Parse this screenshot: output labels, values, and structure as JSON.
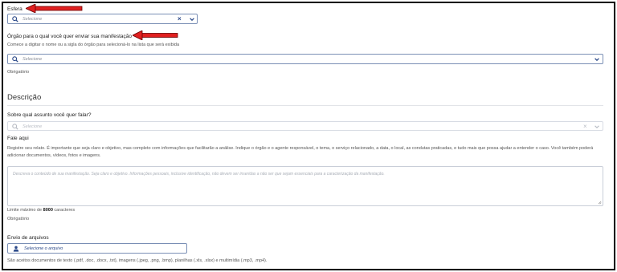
{
  "esfera": {
    "label": "Esfera",
    "placeholder": "Selecione"
  },
  "orgao": {
    "label": "Órgão para o qual você quer enviar sua manifestação",
    "help": "Comece a digitar o nome ou a sigla do órgão para selecioná-lo na lista que será exibida",
    "placeholder": "Selecione",
    "required": "Obrigatório"
  },
  "descricao": {
    "title": "Descrição",
    "assunto_label": "Sobre qual assunto você quer falar?",
    "assunto_placeholder": "Selecione",
    "fale_label": "Fale aqui",
    "instructions": "Registre seu relato. É importante que seja claro e objetivo, mas completo com informações que facilitarão a análise. Indique o órgão e o agente responsável, o tema, o serviço relacionado, a data, o local, as condutas praticadas, e tudo mais que possa ajudar a entender o caso. Você também poderá adicionar documentos, vídeos, fotos e imagens.",
    "textarea_placeholder": "Descreva o conteúdo de sua manifestação. Seja claro e objetivo. Informações pessoais, inclusive identificação, não devem ser inseridas a não ser que sejam essenciais para a caracterização da manifestação.",
    "limit_prefix": "Limite máximo de ",
    "limit_value": "8000",
    "limit_suffix": " caracteres",
    "required": "Obrigatório"
  },
  "arquivos": {
    "label": "Envio de arquivos",
    "button": "Selecione o arquivo",
    "accepted": "São aceitos documentos de texto (.pdf, .doc, .docx, .txt), imagens (.jpeg, .png, .bmp), planilhas (.xls, .xlsx) e multimídia (.mp3, .mp4)."
  },
  "icons": {
    "search": "search-icon",
    "clear": "close-icon",
    "chevron": "chevron-down-icon",
    "user": "user-icon",
    "grip": "resize-grip-icon"
  },
  "colors": {
    "accent": "#2c4a8a",
    "arrow": "#e02020"
  }
}
